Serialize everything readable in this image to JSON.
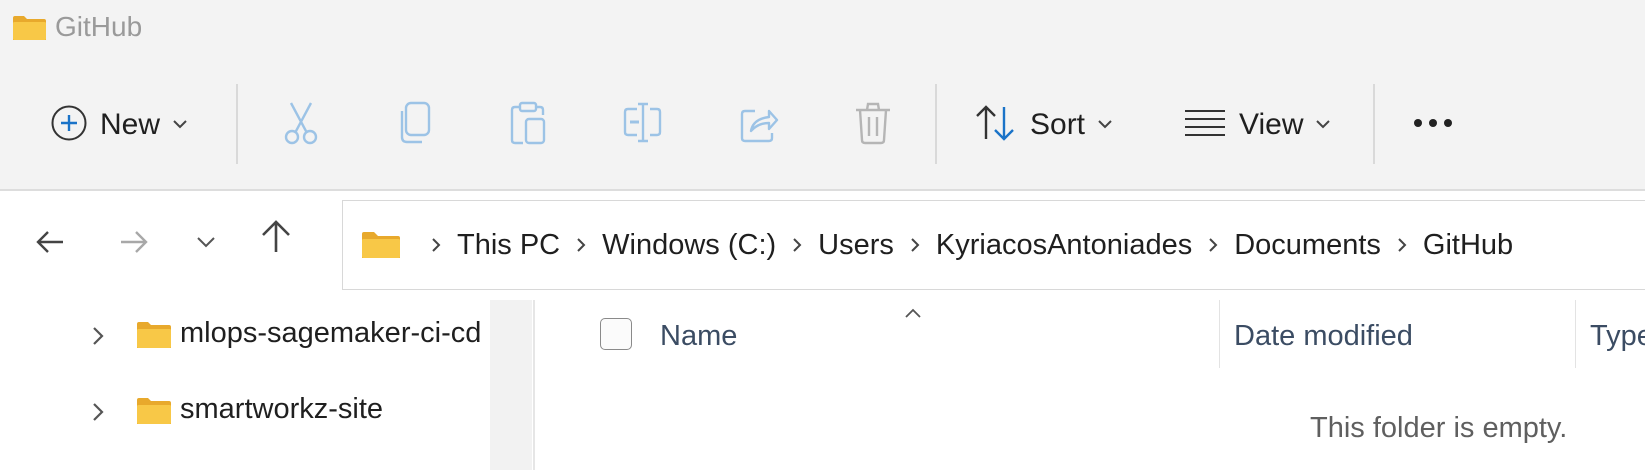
{
  "window": {
    "title": "GitHub",
    "icon": "folder-icon"
  },
  "toolbar": {
    "new_label": "New",
    "sort_label": "Sort",
    "view_label": "View",
    "icons": [
      "plus-circle-icon",
      "cut-icon",
      "copy-icon",
      "paste-icon",
      "rename-icon",
      "share-icon",
      "delete-icon",
      "sort-icon",
      "view-icon",
      "more-icon"
    ]
  },
  "navigation": {
    "icons": [
      "back-arrow-icon",
      "forward-arrow-icon",
      "recent-chevron-icon",
      "up-arrow-icon"
    ]
  },
  "address": {
    "crumbs": [
      "This PC",
      "Windows (C:)",
      "Users",
      "KyriacosAntoniades",
      "Documents",
      "GitHub"
    ]
  },
  "tree": {
    "items": [
      {
        "label": "mlops-sagemaker-ci-cd"
      },
      {
        "label": "smartworkz-site"
      }
    ]
  },
  "columns": {
    "name": "Name",
    "date_modified": "Date modified",
    "type": "Type"
  },
  "content": {
    "empty_message": "This folder is empty."
  },
  "colors": {
    "folder": "#f8c847",
    "accent": "#1a73c8",
    "disabled_icon": "#9cc3e6",
    "header_text": "#3b4c63"
  }
}
